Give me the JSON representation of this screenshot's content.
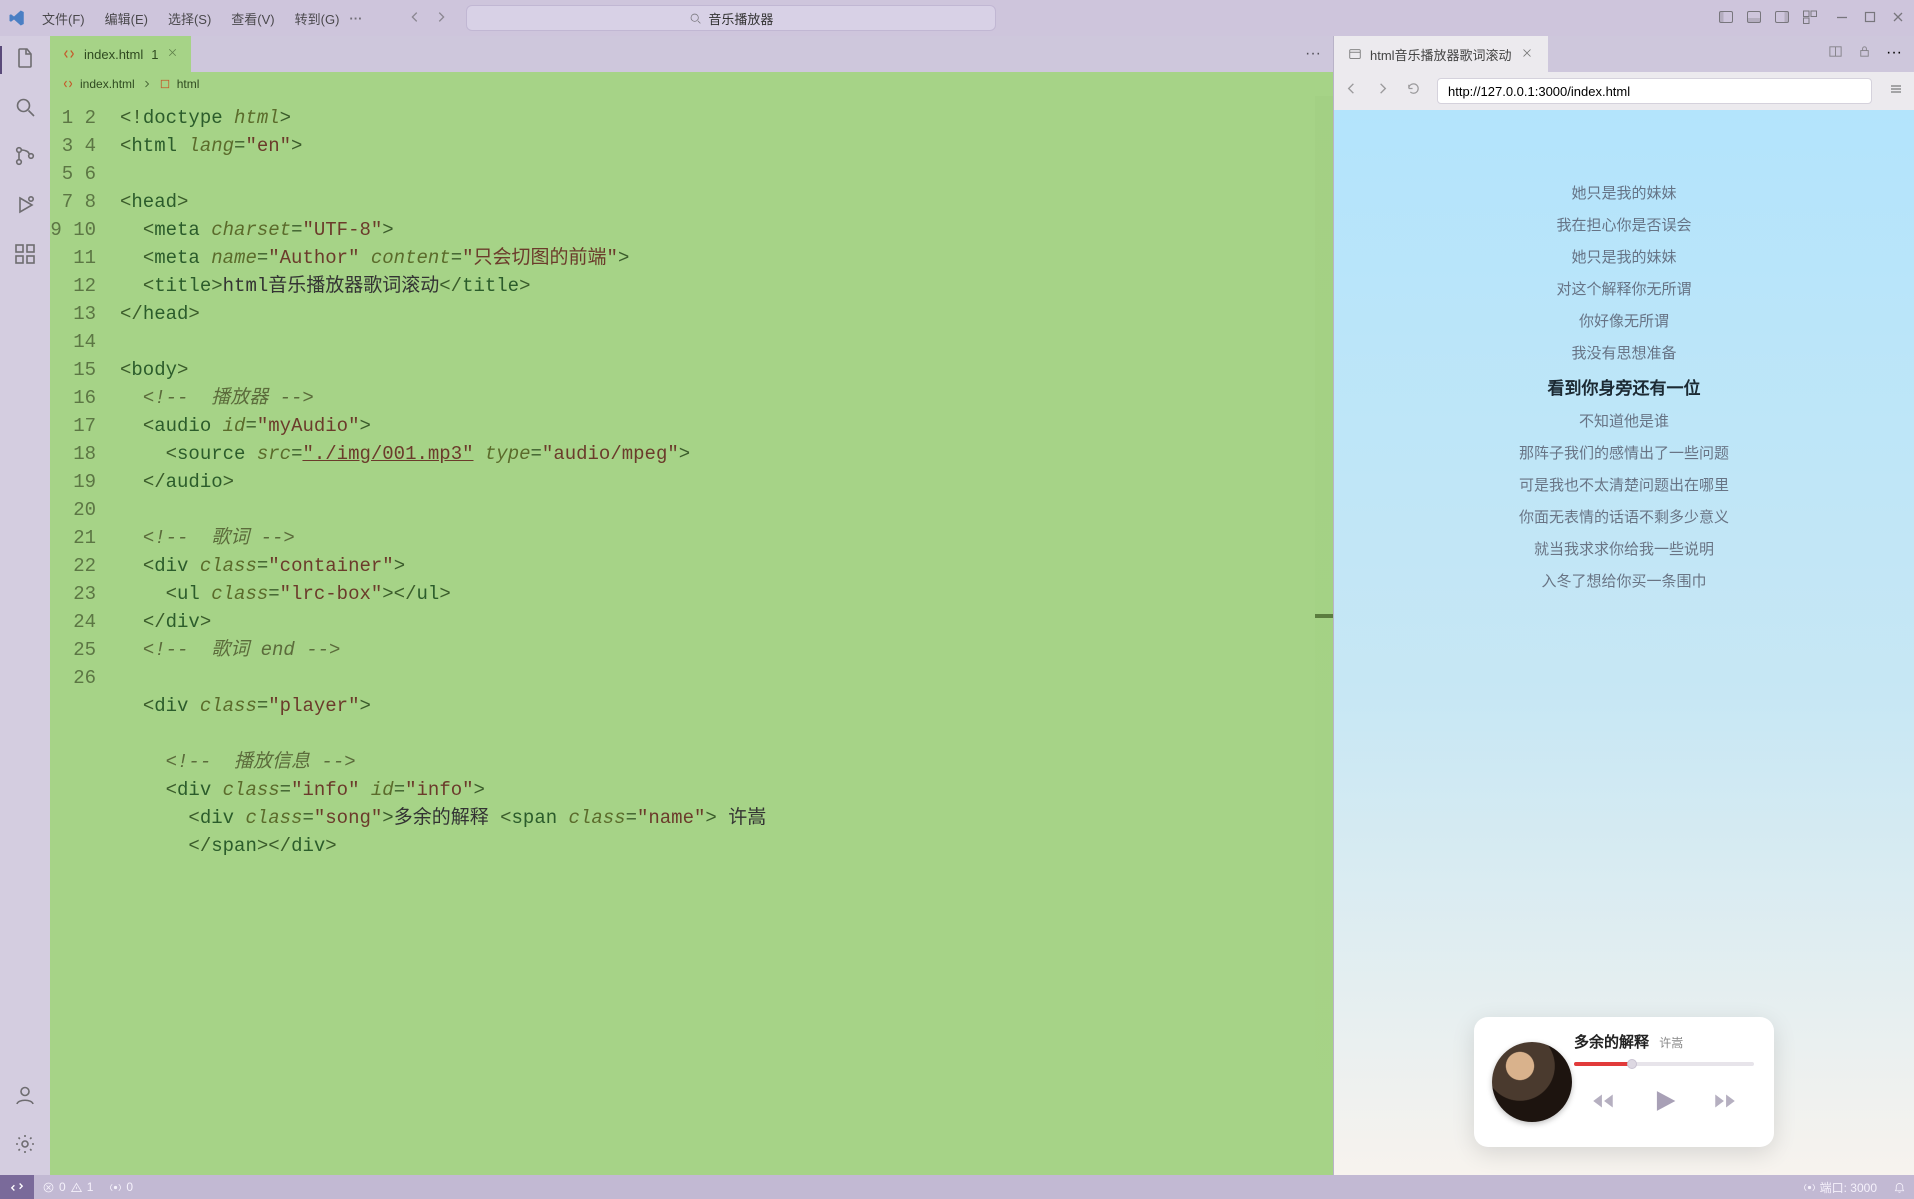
{
  "menu": {
    "file": "文件(F)",
    "edit": "编辑(E)",
    "select": "选择(S)",
    "view": "查看(V)",
    "goto": "转到(G)"
  },
  "search_placeholder": "音乐播放器",
  "tab": {
    "name": "index.html",
    "modified": "1"
  },
  "breadcrumb": {
    "file": "index.html",
    "node": "html"
  },
  "preview_tab": "html音乐播放器歌词滚动",
  "preview_url": "http://127.0.0.1:3000/index.html",
  "lyrics": [
    "她只是我的妹妹",
    "我在担心你是否误会",
    "她只是我的妹妹",
    "对这个解释你无所谓",
    "你好像无所谓",
    "我没有思想准备",
    "看到你身旁还有一位",
    "不知道他是谁",
    "那阵子我们的感情出了一些问题",
    "可是我也不太清楚问题出在哪里",
    "你面无表情的话语不剩多少意义",
    "就当我求求你给我一些说明",
    "入冬了想给你买一条围巾"
  ],
  "lyrics_current_index": 6,
  "player": {
    "song": "多余的解释",
    "artist": "许嵩"
  },
  "status": {
    "errors": "0",
    "warnings": "1",
    "ports": "0",
    "port_label": "端口: 3000"
  },
  "code_title": "html音乐播放器歌词滚动",
  "code_author": "只会切图的前端",
  "code_song": "多余的解释",
  "code_artist": "许嵩"
}
